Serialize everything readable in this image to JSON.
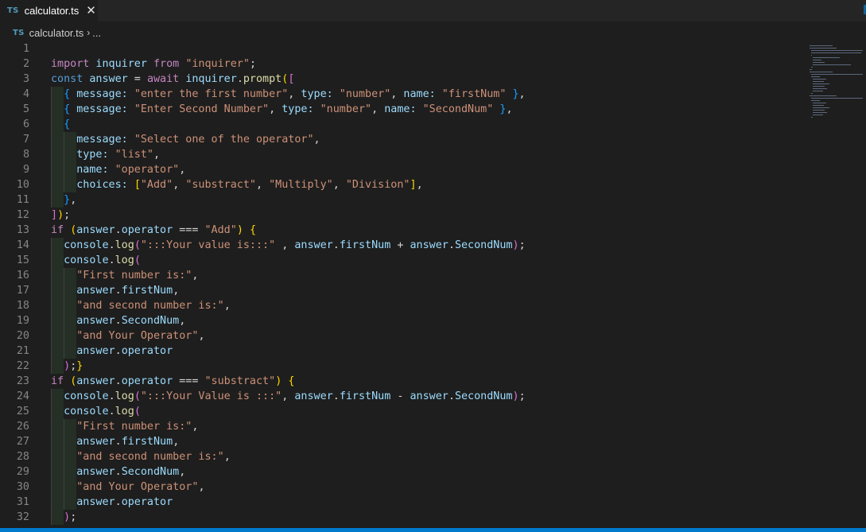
{
  "tab": {
    "badge": "TS",
    "label": "calculator.ts",
    "close": "✕"
  },
  "breadcrumb": {
    "badge": "TS",
    "file": "calculator.ts",
    "separator": "›",
    "more": "..."
  },
  "editor": {
    "line_numbers": [
      "1",
      "2",
      "3",
      "4",
      "5",
      "6",
      "7",
      "8",
      "9",
      "10",
      "11",
      "12",
      "13",
      "14",
      "15",
      "16",
      "17",
      "18",
      "19",
      "20",
      "21",
      "22",
      "23",
      "24",
      "25",
      "26",
      "27",
      "28",
      "29",
      "30",
      "31",
      "32"
    ],
    "lines": [
      [],
      [
        [
          "import",
          "k"
        ],
        [
          " inquirer ",
          "v"
        ],
        [
          "from",
          "k"
        ],
        [
          " ",
          "t"
        ],
        [
          "\"inquirer\"",
          "s"
        ],
        [
          ";",
          "t"
        ]
      ],
      [
        [
          "const",
          "d"
        ],
        [
          " ",
          "t"
        ],
        [
          "answer",
          "v"
        ],
        [
          " = ",
          "t"
        ],
        [
          "await",
          "k"
        ],
        [
          " ",
          "t"
        ],
        [
          "inquirer",
          "v"
        ],
        [
          ".",
          "t"
        ],
        [
          "prompt",
          "f"
        ],
        [
          "(",
          "b1"
        ],
        [
          "[",
          "b2"
        ]
      ],
      [
        [
          "  ",
          "t"
        ],
        [
          "{",
          "b3"
        ],
        [
          " message: ",
          "v"
        ],
        [
          "\"enter the first number\"",
          "s"
        ],
        [
          ", ",
          "t"
        ],
        [
          "type:",
          "v"
        ],
        [
          " ",
          "t"
        ],
        [
          "\"number\"",
          "s"
        ],
        [
          ", ",
          "t"
        ],
        [
          "name:",
          "v"
        ],
        [
          " ",
          "t"
        ],
        [
          "\"firstNum\"",
          "s"
        ],
        [
          " ",
          "t"
        ],
        [
          "}",
          "b3"
        ],
        [
          ",",
          "t"
        ]
      ],
      [
        [
          "  ",
          "t"
        ],
        [
          "{",
          "b3"
        ],
        [
          " message: ",
          "v"
        ],
        [
          "\"Enter Second Number\"",
          "s"
        ],
        [
          ", ",
          "t"
        ],
        [
          "type:",
          "v"
        ],
        [
          " ",
          "t"
        ],
        [
          "\"number\"",
          "s"
        ],
        [
          ", ",
          "t"
        ],
        [
          "name:",
          "v"
        ],
        [
          " ",
          "t"
        ],
        [
          "\"SecondNum\"",
          "s"
        ],
        [
          " ",
          "t"
        ],
        [
          "}",
          "b3"
        ],
        [
          ",",
          "t"
        ]
      ],
      [
        [
          "  ",
          "t"
        ],
        [
          "{",
          "b3"
        ]
      ],
      [
        [
          "    ",
          "t"
        ],
        [
          "message:",
          "v"
        ],
        [
          " ",
          "t"
        ],
        [
          "\"Select one of the operator\"",
          "s"
        ],
        [
          ",",
          "t"
        ]
      ],
      [
        [
          "    ",
          "t"
        ],
        [
          "type:",
          "v"
        ],
        [
          " ",
          "t"
        ],
        [
          "\"list\"",
          "s"
        ],
        [
          ",",
          "t"
        ]
      ],
      [
        [
          "    ",
          "t"
        ],
        [
          "name:",
          "v"
        ],
        [
          " ",
          "t"
        ],
        [
          "\"operator\"",
          "s"
        ],
        [
          ",",
          "t"
        ]
      ],
      [
        [
          "    ",
          "t"
        ],
        [
          "choices:",
          "v"
        ],
        [
          " ",
          "t"
        ],
        [
          "[",
          "b1"
        ],
        [
          "\"Add\"",
          "s"
        ],
        [
          ", ",
          "t"
        ],
        [
          "\"substract\"",
          "s"
        ],
        [
          ", ",
          "t"
        ],
        [
          "\"Multiply\"",
          "s"
        ],
        [
          ", ",
          "t"
        ],
        [
          "\"Division\"",
          "s"
        ],
        [
          "]",
          "b1"
        ],
        [
          ",",
          "t"
        ]
      ],
      [
        [
          "  ",
          "t"
        ],
        [
          "}",
          "b3"
        ],
        [
          ",",
          "t"
        ]
      ],
      [
        [
          "]",
          "b2"
        ],
        [
          ")",
          "b1"
        ],
        [
          ";",
          "t"
        ]
      ],
      [
        [
          "if",
          "k"
        ],
        [
          " ",
          "t"
        ],
        [
          "(",
          "b1"
        ],
        [
          "answer",
          "v"
        ],
        [
          ".",
          "t"
        ],
        [
          "operator",
          "v"
        ],
        [
          " === ",
          "t"
        ],
        [
          "\"Add\"",
          "s"
        ],
        [
          ")",
          "b1"
        ],
        [
          " ",
          "t"
        ],
        [
          "{",
          "b1"
        ]
      ],
      [
        [
          "  ",
          "t"
        ],
        [
          "console",
          "v"
        ],
        [
          ".",
          "t"
        ],
        [
          "log",
          "f"
        ],
        [
          "(",
          "b2"
        ],
        [
          "\":::Your value is:::\"",
          "s"
        ],
        [
          " , ",
          "t"
        ],
        [
          "answer",
          "v"
        ],
        [
          ".",
          "t"
        ],
        [
          "firstNum",
          "v"
        ],
        [
          " + ",
          "t"
        ],
        [
          "answer",
          "v"
        ],
        [
          ".",
          "t"
        ],
        [
          "SecondNum",
          "v"
        ],
        [
          ")",
          "b2"
        ],
        [
          ";",
          "t"
        ]
      ],
      [
        [
          "  ",
          "t"
        ],
        [
          "console",
          "v"
        ],
        [
          ".",
          "t"
        ],
        [
          "log",
          "f"
        ],
        [
          "(",
          "b2"
        ]
      ],
      [
        [
          "    ",
          "t"
        ],
        [
          "\"First number is:\"",
          "s"
        ],
        [
          ",",
          "t"
        ]
      ],
      [
        [
          "    ",
          "t"
        ],
        [
          "answer",
          "v"
        ],
        [
          ".",
          "t"
        ],
        [
          "firstNum",
          "v"
        ],
        [
          ",",
          "t"
        ]
      ],
      [
        [
          "    ",
          "t"
        ],
        [
          "\"and second number is:\"",
          "s"
        ],
        [
          ",",
          "t"
        ]
      ],
      [
        [
          "    ",
          "t"
        ],
        [
          "answer",
          "v"
        ],
        [
          ".",
          "t"
        ],
        [
          "SecondNum",
          "v"
        ],
        [
          ",",
          "t"
        ]
      ],
      [
        [
          "    ",
          "t"
        ],
        [
          "\"and Your Operator\"",
          "s"
        ],
        [
          ",",
          "t"
        ]
      ],
      [
        [
          "    ",
          "t"
        ],
        [
          "answer",
          "v"
        ],
        [
          ".",
          "t"
        ],
        [
          "operator",
          "v"
        ]
      ],
      [
        [
          "  ",
          "t"
        ],
        [
          ")",
          "b2"
        ],
        [
          ";",
          "t"
        ],
        [
          "}",
          "b1"
        ]
      ],
      [
        [
          "if",
          "k"
        ],
        [
          " ",
          "t"
        ],
        [
          "(",
          "b1"
        ],
        [
          "answer",
          "v"
        ],
        [
          ".",
          "t"
        ],
        [
          "operator",
          "v"
        ],
        [
          " === ",
          "t"
        ],
        [
          "\"substract\"",
          "s"
        ],
        [
          ")",
          "b1"
        ],
        [
          " ",
          "t"
        ],
        [
          "{",
          "b1"
        ]
      ],
      [
        [
          "  ",
          "t"
        ],
        [
          "console",
          "v"
        ],
        [
          ".",
          "t"
        ],
        [
          "log",
          "f"
        ],
        [
          "(",
          "b2"
        ],
        [
          "\":::Your Value is :::\"",
          "s"
        ],
        [
          ", ",
          "t"
        ],
        [
          "answer",
          "v"
        ],
        [
          ".",
          "t"
        ],
        [
          "firstNum",
          "v"
        ],
        [
          " - ",
          "t"
        ],
        [
          "answer",
          "v"
        ],
        [
          ".",
          "t"
        ],
        [
          "SecondNum",
          "v"
        ],
        [
          ")",
          "b2"
        ],
        [
          ";",
          "t"
        ]
      ],
      [
        [
          "  ",
          "t"
        ],
        [
          "console",
          "v"
        ],
        [
          ".",
          "t"
        ],
        [
          "log",
          "f"
        ],
        [
          "(",
          "b2"
        ]
      ],
      [
        [
          "    ",
          "t"
        ],
        [
          "\"First number is:\"",
          "s"
        ],
        [
          ",",
          "t"
        ]
      ],
      [
        [
          "    ",
          "t"
        ],
        [
          "answer",
          "v"
        ],
        [
          ".",
          "t"
        ],
        [
          "firstNum",
          "v"
        ],
        [
          ",",
          "t"
        ]
      ],
      [
        [
          "    ",
          "t"
        ],
        [
          "\"and second number is:\"",
          "s"
        ],
        [
          ",",
          "t"
        ]
      ],
      [
        [
          "    ",
          "t"
        ],
        [
          "answer",
          "v"
        ],
        [
          ".",
          "t"
        ],
        [
          "SecondNum",
          "v"
        ],
        [
          ",",
          "t"
        ]
      ],
      [
        [
          "    ",
          "t"
        ],
        [
          "\"and Your Operator\"",
          "s"
        ],
        [
          ",",
          "t"
        ]
      ],
      [
        [
          "    ",
          "t"
        ],
        [
          "answer",
          "v"
        ],
        [
          ".",
          "t"
        ],
        [
          "operator",
          "v"
        ]
      ],
      [
        [
          "  ",
          "t"
        ],
        [
          ")",
          "b2"
        ],
        [
          ";",
          "t"
        ]
      ]
    ]
  },
  "colors": {
    "background": "#1e1e1e",
    "tabbar": "#252526",
    "statusbar": "#007acc",
    "ts_badge": "#519aba",
    "keyword": "#c586c0",
    "declaration": "#569cd6",
    "variable": "#9cdcfe",
    "function": "#dcdcaa",
    "string": "#ce9178"
  }
}
